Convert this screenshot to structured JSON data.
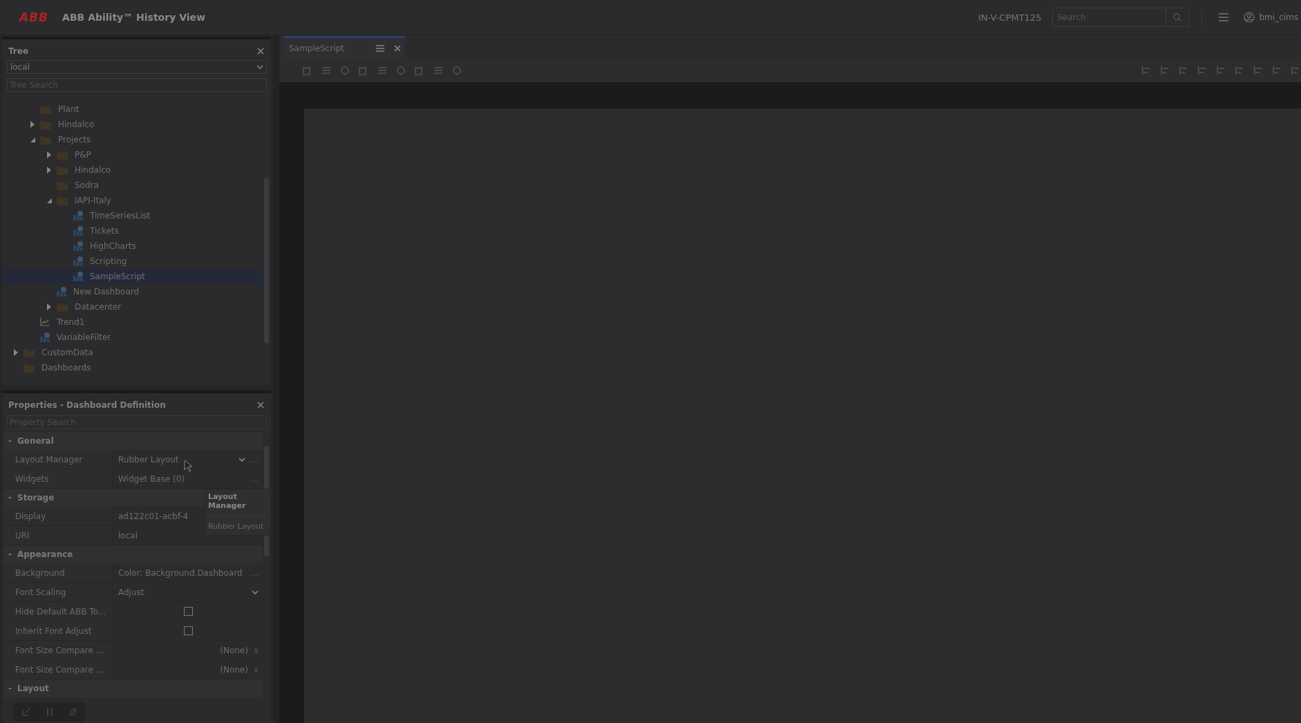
{
  "header": {
    "logo": "ABB",
    "title": "ABB Ability™ History View",
    "host": "IN-V-CPMT125",
    "search": {
      "placeholder": "Search"
    },
    "user": "bmi_cims"
  },
  "tree": {
    "title": "Tree",
    "source": "local",
    "search": {
      "placeholder": "Tree Search"
    },
    "items": [
      {
        "children": [
          {
            "label": "Plant",
            "kind": "folder"
          },
          {
            "label": "Hindalco",
            "kind": "folder",
            "expanded": false
          },
          {
            "label": "Projects",
            "kind": "folder",
            "expanded": true,
            "children": [
              {
                "label": "P&P",
                "kind": "folder",
                "expanded": false
              },
              {
                "label": "Hindalco",
                "kind": "folder",
                "expanded": false
              },
              {
                "label": "Sodra",
                "kind": "folder"
              },
              {
                "label": "IAPI-Italy",
                "kind": "folder",
                "expanded": true,
                "children": [
                  {
                    "label": "TimeSeriesList",
                    "kind": "dashboard",
                    "selected": false
                  },
                  {
                    "label": "Tickets",
                    "kind": "dashboard",
                    "selected": false
                  },
                  {
                    "label": "HighCharts",
                    "kind": "dashboard",
                    "selected": false
                  },
                  {
                    "label": "Scripting",
                    "kind": "dashboard",
                    "selected": false
                  },
                  {
                    "label": "SampleScript",
                    "kind": "dashboard",
                    "selected": true
                  }
                ]
              },
              {
                "label": "New Dashboard",
                "kind": "dashboard",
                "selected": false
              },
              {
                "label": "Datacenter",
                "kind": "folder",
                "expanded": false
              }
            ]
          },
          {
            "label": "Trend1",
            "kind": "trend",
            "selected": false
          },
          {
            "label": "VariableFilter",
            "kind": "dashboard",
            "selected": false
          }
        ]
      },
      {
        "label": "CustomData",
        "kind": "folder",
        "expanded": false
      },
      {
        "label": "Dashboards",
        "kind": "folder"
      }
    ]
  },
  "properties": {
    "title": "Properties - Dashboard Definition",
    "search": {
      "placeholder": "Property Search"
    },
    "sections": [
      {
        "name": "General",
        "toggle": "-",
        "rows": [
          {
            "label": "Layout Manager",
            "kind": "dropdown",
            "value": "Rubber Layout",
            "more": "..."
          },
          {
            "label": "Widgets",
            "kind": "text",
            "value": "Widget Base (0)",
            "more": "..."
          }
        ]
      },
      {
        "name": "Storage",
        "toggle": "-",
        "rows": [
          {
            "label": "Display",
            "kind": "text",
            "value": "ad122c01-acbf-4"
          },
          {
            "label": "URI",
            "kind": "text",
            "value": "local"
          }
        ]
      },
      {
        "name": "Appearance",
        "toggle": "-",
        "rows": [
          {
            "label": "Background",
            "kind": "text",
            "value": "Color: Background.Dashboard",
            "more": "..."
          },
          {
            "label": "Font Scaling",
            "kind": "dropdown",
            "value": "Adjust"
          },
          {
            "label": "Hide Default ABB To...",
            "kind": "checkbox",
            "checked": false
          },
          {
            "label": "Inherit Font Adjust",
            "kind": "checkbox",
            "checked": false
          },
          {
            "label": "Font Size Compare ...",
            "kind": "nullable",
            "value": "(None)",
            "clear": "x"
          },
          {
            "label": "Font Size Compare ...",
            "kind": "nullable",
            "value": "(None)",
            "clear": "x"
          }
        ]
      },
      {
        "name": "Layout",
        "toggle": "-"
      }
    ],
    "tooltip": {
      "title": "Layout Manager",
      "text": "Rubber Layout"
    }
  },
  "tabs": [
    {
      "label": "SampleScript",
      "selected": true
    }
  ]
}
